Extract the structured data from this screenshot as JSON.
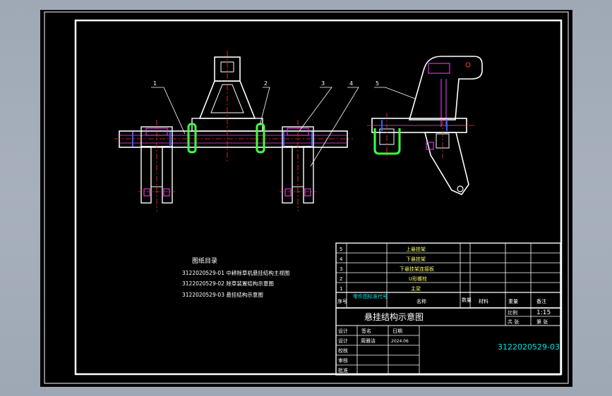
{
  "drawing": {
    "colors": {
      "background": "#000000",
      "frame": "#ffffff",
      "table_line": "#ffffff",
      "text_white": "#ffffff",
      "text_cyan": "#00e5e5",
      "text_yellow": "#ffff66",
      "part": "#ffffff",
      "center_line": "#ff3030",
      "hidden_line": "#ff40ff",
      "u_bolt": "#40ff40",
      "hatch": "#3060ff"
    },
    "balloons": [
      "1",
      "2",
      "3",
      "4",
      "5"
    ],
    "drawing_index": {
      "title": "图纸目录",
      "items": [
        "3122020529-01 中耕除草机悬挂结构主视图",
        "3122020529-02 除草装置结构示意图",
        "3122020529-03 悬挂结构示意图"
      ]
    },
    "parts_list": {
      "rows": [
        {
          "no": "5",
          "name": "上悬挂架"
        },
        {
          "no": "4",
          "name": "下悬挂架"
        },
        {
          "no": "3",
          "name": "下悬挂架连接板"
        },
        {
          "no": "2",
          "name": "U形螺栓"
        },
        {
          "no": "1",
          "name": "主梁"
        }
      ],
      "header": {
        "no": "序号",
        "code": "零件图标准代号",
        "name": "名称",
        "qty": "数量",
        "material": "材料",
        "weight": "重量",
        "remark": "备注"
      }
    },
    "title_block": {
      "drawing_title": "悬挂结构示意图",
      "scale_label": "比例",
      "scale_value": "1:15",
      "sheet_total": "共 张",
      "sheet_no": "第 张",
      "drawing_number": "3122020529-03",
      "sign_rows": [
        "设计",
        "设计",
        "校核",
        "审核",
        "批准"
      ],
      "signature_header": "签名",
      "date_header": "日期",
      "designer": "周雅洁",
      "date": "2024.06"
    }
  }
}
